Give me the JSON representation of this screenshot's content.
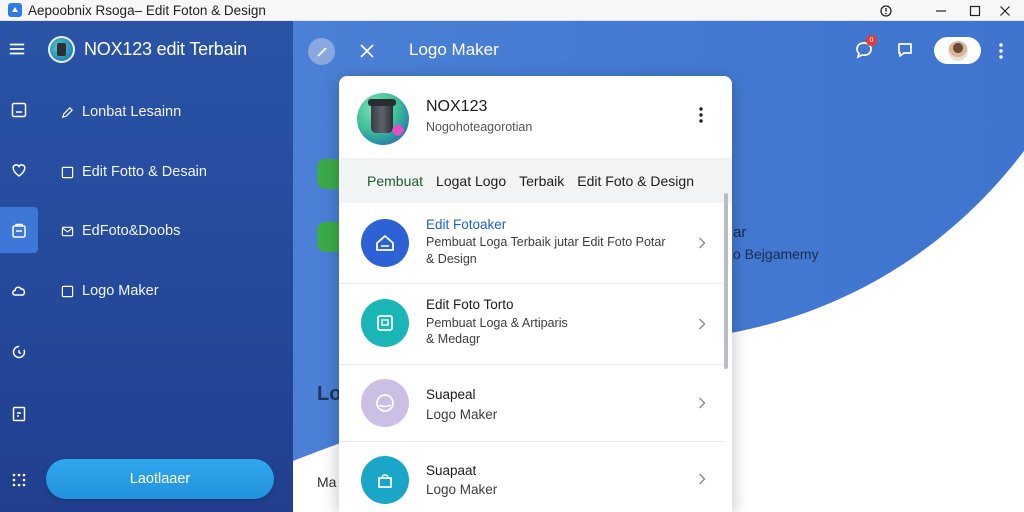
{
  "window": {
    "title": "Aepoobnix Rsoga– Edit Foton & Design",
    "controls": [
      "help-icon",
      "minimize-icon",
      "maximize-icon",
      "close-icon"
    ]
  },
  "sidebar": {
    "brand_name": "NOX123 edit Terbain",
    "items": [
      {
        "label": "Lonbat Lesainn",
        "icon": "edit-icon"
      },
      {
        "label": "Edit Fotto & Desain",
        "icon": "square-icon"
      },
      {
        "label": "EdFoto&Doobs",
        "icon": "mail-icon"
      },
      {
        "label": "Logo Maker",
        "icon": "square-icon"
      }
    ],
    "rail_icons": [
      "image-icon",
      "heart-icon",
      "bag-icon",
      "cloud-icon",
      "refresh-icon",
      "doc-icon",
      "grid-icon"
    ],
    "button_label": "Laotlaaer"
  },
  "header": {
    "title": "Logo Maker",
    "notification_count": "0"
  },
  "background": {
    "line1": "ar",
    "line2": "o Bejgamemy",
    "heading_fragment": "Lo",
    "footer_fragment": "Ma"
  },
  "card": {
    "name": "NOX123",
    "subtitle": "Nogohoteagorotian",
    "tags": [
      "Pembuat",
      "Logat Logo",
      "Terbaik",
      "Edit Foto & Design"
    ],
    "rows": [
      {
        "title": "Edit Fotoaker",
        "desc1": "Pembuat Loga Terbaik jutar Edit Foto Potar",
        "desc2": "& Design",
        "color": "#2e60d6",
        "icon": "home-icon",
        "title_color": "#1c62c8"
      },
      {
        "title": "Edit Foto Torto",
        "desc1": "Pembuat Loga & Artiparis",
        "desc2": "& Medagr",
        "color": "#1ab5b7",
        "icon": "frame-icon",
        "title_color": "#1b1b1b"
      },
      {
        "title": "Suapeal",
        "desc1": "Logo Maker",
        "desc2": "",
        "color": "#cbbfe6",
        "icon": "circle-icon",
        "title_color": "#1b1b1b"
      },
      {
        "title": "Suapaat",
        "desc1": "Logo Maker",
        "desc2": "",
        "color": "#1aa6c8",
        "icon": "box-icon",
        "title_color": "#1b1b1b"
      }
    ]
  },
  "colors": {
    "sidebar": "#24489a",
    "header": "#4a80d8",
    "accent": "#2393e0"
  }
}
